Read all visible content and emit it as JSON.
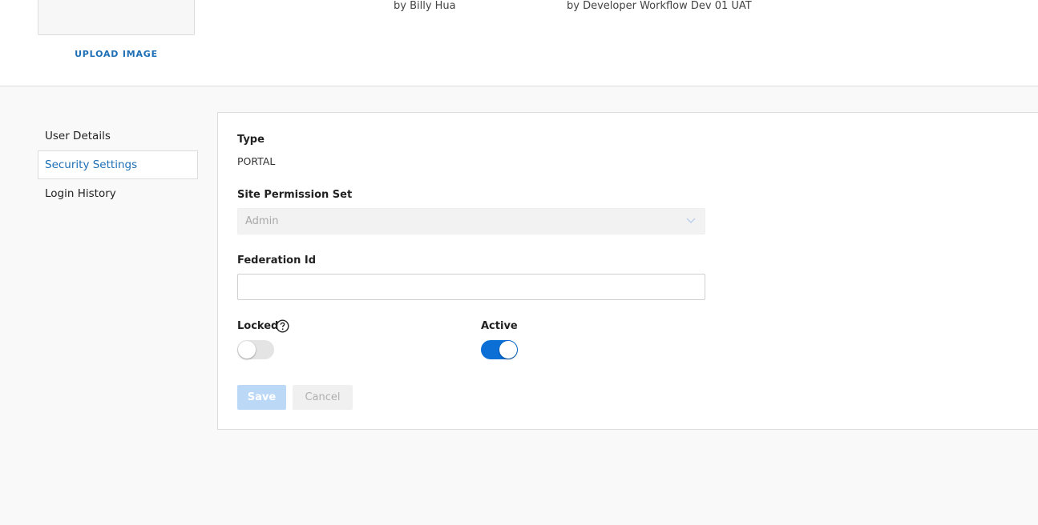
{
  "profile": {
    "upload_label": "UPLOAD IMAGE",
    "created_by": "by Billy Hua",
    "modified_by": "by Developer Workflow Dev 01 UAT"
  },
  "nav": {
    "items": [
      {
        "label": "User Details"
      },
      {
        "label": "Security Settings",
        "active": true
      },
      {
        "label": "Login History"
      }
    ]
  },
  "form": {
    "type_label": "Type",
    "type_value": "PORTAL",
    "permission_label": "Site Permission Set",
    "permission_value": "Admin",
    "federation_label": "Federation Id",
    "federation_value": "",
    "locked_label": "Locked",
    "locked_value": false,
    "active_label": "Active",
    "active_value": true,
    "save_label": "Save",
    "cancel_label": "Cancel"
  },
  "colors": {
    "accent": "#1e6fb5",
    "toggle_on": "#0b6fd6",
    "save_disabled": "#bcd8f7"
  }
}
